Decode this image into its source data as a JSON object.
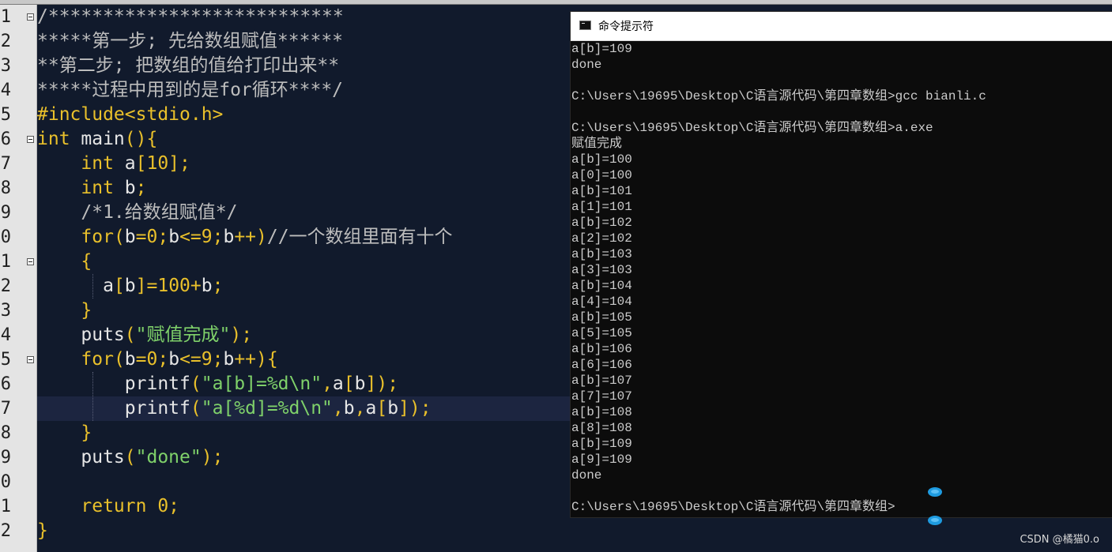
{
  "editor": {
    "line_numbers": [
      "1",
      "2",
      "3",
      "4",
      "5",
      "6",
      "7",
      "8",
      "9",
      "0",
      "1",
      "2",
      "3",
      "4",
      "5",
      "6",
      "7",
      "8",
      "9",
      "0",
      "1",
      "2"
    ],
    "lines": [
      [
        {
          "t": "/***************************",
          "c": "c-comment"
        }
      ],
      [
        {
          "t": "*****第一步; 先给数组赋值******",
          "c": "c-comment"
        }
      ],
      [
        {
          "t": "**第二步; 把数组的值给打印出来**",
          "c": "c-comment"
        }
      ],
      [
        {
          "t": "*****过程中用到的是for循环****/",
          "c": "c-comment"
        }
      ],
      [
        {
          "t": "#include<stdio.h>",
          "c": "c-pre"
        }
      ],
      [
        {
          "t": "int",
          "c": "c-kw"
        },
        {
          "t": " main",
          "c": "c-id"
        },
        {
          "t": "(){",
          "c": "c-punc"
        }
      ],
      [
        {
          "t": "    ",
          "c": "c-id"
        },
        {
          "t": "int",
          "c": "c-kw"
        },
        {
          "t": " a",
          "c": "c-id"
        },
        {
          "t": "[10];",
          "c": "c-punc"
        }
      ],
      [
        {
          "t": "    ",
          "c": "c-id"
        },
        {
          "t": "int",
          "c": "c-kw"
        },
        {
          "t": " b",
          "c": "c-id"
        },
        {
          "t": ";",
          "c": "c-punc"
        }
      ],
      [
        {
          "t": "    /*1.给数组赋值*/",
          "c": "c-comment"
        }
      ],
      [
        {
          "t": "    ",
          "c": "c-id"
        },
        {
          "t": "for",
          "c": "c-kw"
        },
        {
          "t": "(",
          "c": "c-punc"
        },
        {
          "t": "b",
          "c": "c-id"
        },
        {
          "t": "=0;",
          "c": "c-punc"
        },
        {
          "t": "b",
          "c": "c-id"
        },
        {
          "t": "<=9;",
          "c": "c-punc"
        },
        {
          "t": "b",
          "c": "c-id"
        },
        {
          "t": "++)",
          "c": "c-punc"
        },
        {
          "t": "//一个数组里面有十个",
          "c": "c-comment"
        }
      ],
      [
        {
          "t": "    {",
          "c": "c-punc"
        }
      ],
      [
        {
          "t": "      a",
          "c": "c-id"
        },
        {
          "t": "[",
          "c": "c-punc"
        },
        {
          "t": "b",
          "c": "c-id"
        },
        {
          "t": "]=100+",
          "c": "c-punc"
        },
        {
          "t": "b",
          "c": "c-id"
        },
        {
          "t": ";",
          "c": "c-punc"
        }
      ],
      [
        {
          "t": "    }",
          "c": "c-punc"
        }
      ],
      [
        {
          "t": "    puts",
          "c": "c-id"
        },
        {
          "t": "(",
          "c": "c-punc"
        },
        {
          "t": "\"赋值完成\"",
          "c": "c-str"
        },
        {
          "t": ");",
          "c": "c-punc"
        }
      ],
      [
        {
          "t": "    ",
          "c": "c-id"
        },
        {
          "t": "for",
          "c": "c-kw"
        },
        {
          "t": "(",
          "c": "c-punc"
        },
        {
          "t": "b",
          "c": "c-id"
        },
        {
          "t": "=0;",
          "c": "c-punc"
        },
        {
          "t": "b",
          "c": "c-id"
        },
        {
          "t": "<=9;",
          "c": "c-punc"
        },
        {
          "t": "b",
          "c": "c-id"
        },
        {
          "t": "++){",
          "c": "c-punc"
        }
      ],
      [
        {
          "t": "        printf",
          "c": "c-id"
        },
        {
          "t": "(",
          "c": "c-punc"
        },
        {
          "t": "\"a[b]=%d\\n\"",
          "c": "c-str"
        },
        {
          "t": ",",
          "c": "c-punc"
        },
        {
          "t": "a",
          "c": "c-id"
        },
        {
          "t": "[",
          "c": "c-punc"
        },
        {
          "t": "b",
          "c": "c-id"
        },
        {
          "t": "]);",
          "c": "c-punc"
        }
      ],
      [
        {
          "t": "        printf",
          "c": "c-id"
        },
        {
          "t": "(",
          "c": "c-punc"
        },
        {
          "t": "\"a[%d]=%d\\n\"",
          "c": "c-str"
        },
        {
          "t": ",",
          "c": "c-punc"
        },
        {
          "t": "b",
          "c": "c-id"
        },
        {
          "t": ",",
          "c": "c-punc"
        },
        {
          "t": "a",
          "c": "c-id"
        },
        {
          "t": "[",
          "c": "c-punc"
        },
        {
          "t": "b",
          "c": "c-id"
        },
        {
          "t": "]);",
          "c": "c-punc"
        }
      ],
      [
        {
          "t": "    }",
          "c": "c-punc"
        }
      ],
      [
        {
          "t": "    puts",
          "c": "c-id"
        },
        {
          "t": "(",
          "c": "c-punc"
        },
        {
          "t": "\"done\"",
          "c": "c-str"
        },
        {
          "t": ");",
          "c": "c-punc"
        }
      ],
      [
        {
          "t": "",
          "c": "c-id"
        }
      ],
      [
        {
          "t": "    ",
          "c": "c-id"
        },
        {
          "t": "return",
          "c": "c-kw"
        },
        {
          "t": " 0;",
          "c": "c-num"
        }
      ],
      [
        {
          "t": "}",
          "c": "c-punc"
        }
      ]
    ]
  },
  "console": {
    "title": "命令提示符",
    "lines": [
      "a[b]=109",
      "done",
      "",
      "C:\\Users\\19695\\Desktop\\C语言源代码\\第四章数组>gcc bianli.c",
      "",
      "C:\\Users\\19695\\Desktop\\C语言源代码\\第四章数组>a.exe",
      "赋值完成",
      "a[b]=100",
      "a[0]=100",
      "a[b]=101",
      "a[1]=101",
      "a[b]=102",
      "a[2]=102",
      "a[b]=103",
      "a[3]=103",
      "a[b]=104",
      "a[4]=104",
      "a[b]=105",
      "a[5]=105",
      "a[b]=106",
      "a[6]=106",
      "a[b]=107",
      "a[7]=107",
      "a[b]=108",
      "a[8]=108",
      "a[b]=109",
      "a[9]=109",
      "done",
      "",
      "C:\\Users\\19695\\Desktop\\C语言源代码\\第四章数组>"
    ]
  },
  "watermark": "CSDN @橘猫0.o"
}
